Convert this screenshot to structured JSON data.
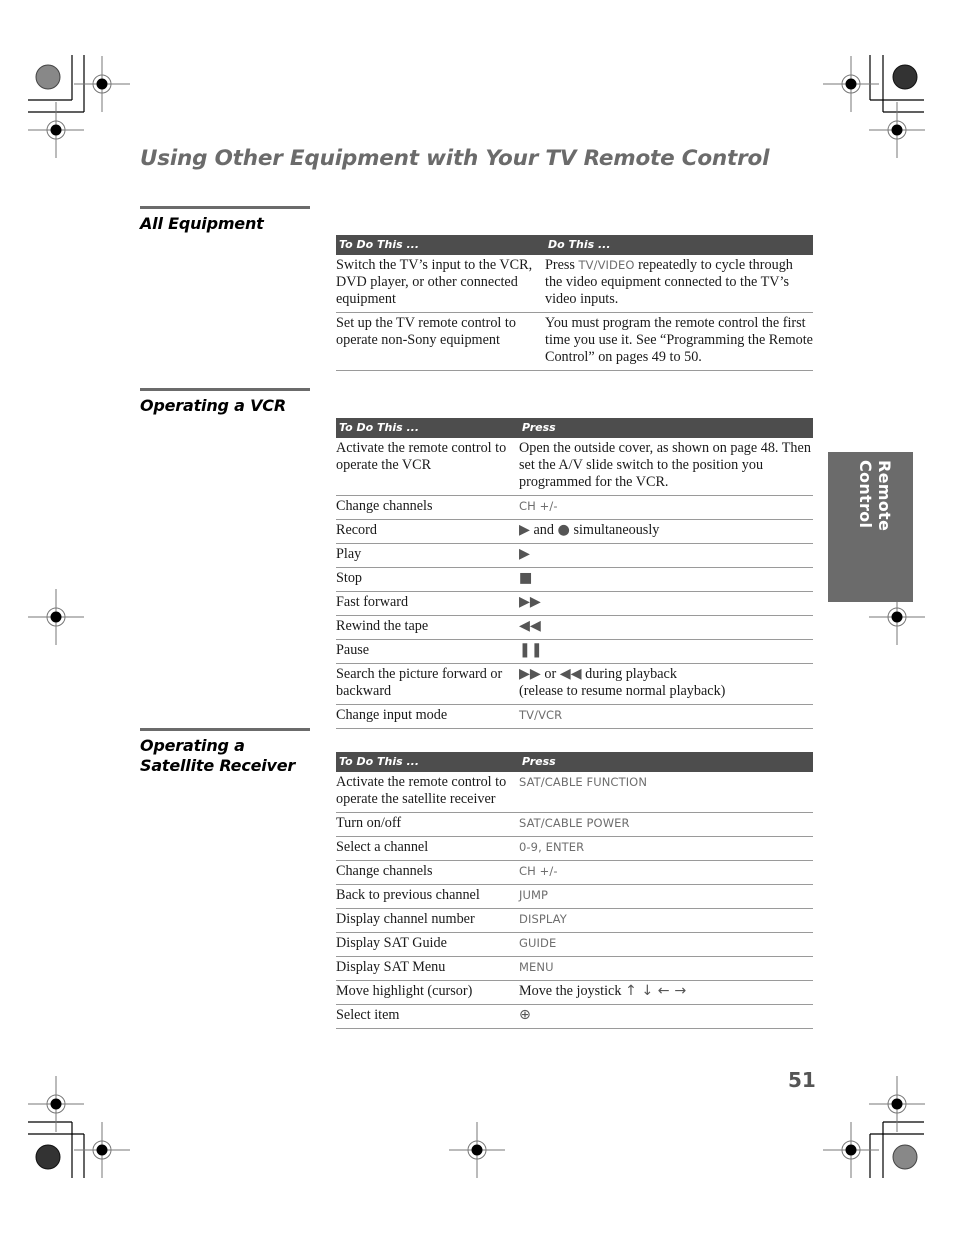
{
  "page": {
    "title": "Using Other Equipment with Your TV Remote Control",
    "side_tab": "Remote Control",
    "page_number": "51"
  },
  "sections": [
    {
      "title": "All Equipment",
      "headers": [
        "To Do This ...",
        "Do This ..."
      ],
      "rows": [
        {
          "action": "Switch the TV’s input to the VCR, DVD player, or other connected equipment",
          "pre": "Press ",
          "button": "TV/VIDEO",
          "post": " repeatedly to cycle through the video equipment connected to the TV’s video inputs."
        },
        {
          "action": "Set up the TV remote control to operate non-Sony equipment",
          "pre": "You must program the remote control the first time you use it. See “Programming the Remote Control” on pages 49 to 50.",
          "button": "",
          "post": ""
        }
      ]
    },
    {
      "title": "Operating a VCR",
      "headers": [
        "To Do This ...",
        "Press"
      ],
      "rows": [
        {
          "action": "Activate the remote control to operate the VCR",
          "pre": "Open the outside cover, as shown on page 48. Then set the A/V slide switch to the position you programmed for the VCR.",
          "button": "",
          "post": ""
        },
        {
          "action": "Change channels",
          "pre": "",
          "button": "CH +/-",
          "post": ""
        },
        {
          "action": "Record",
          "icons": [
            "play-icon"
          ],
          "pre": " and ",
          "icons2": [
            "record-icon"
          ],
          "post": " simultaneously"
        },
        {
          "action": "Play",
          "icons": [
            "play-icon"
          ]
        },
        {
          "action": "Stop",
          "icons": [
            "stop-icon"
          ]
        },
        {
          "action": "Fast forward",
          "icons": [
            "fast-forward-icon"
          ]
        },
        {
          "action": "Rewind the tape",
          "icons": [
            "rewind-icon"
          ]
        },
        {
          "action": "Pause",
          "icons": [
            "pause-icon"
          ]
        },
        {
          "action": "Search the picture forward or backward",
          "icons": [
            "fast-forward-icon"
          ],
          "pre": " or ",
          "icons2": [
            "rewind-icon"
          ],
          "post": " during playback",
          "line2": "(release to resume normal playback)"
        },
        {
          "action": "Change input mode",
          "pre": "",
          "button": "TV/VCR",
          "post": ""
        }
      ]
    },
    {
      "title_line1": "Operating a",
      "title_line2": "Satellite Receiver",
      "headers": [
        "To Do This ...",
        "Press"
      ],
      "rows": [
        {
          "action": "Activate the remote control to operate the satellite receiver",
          "button": "SAT/CABLE FUNCTION"
        },
        {
          "action": "Turn on/off",
          "button": "SAT/CABLE POWER"
        },
        {
          "action": "Select a channel",
          "button": "0-9, ENTER"
        },
        {
          "action": "Change channels",
          "button": "CH +/-"
        },
        {
          "action": "Back to previous channel",
          "button": "JUMP"
        },
        {
          "action": "Display channel number",
          "button": "DISPLAY"
        },
        {
          "action": "Display SAT Guide",
          "button": "GUIDE"
        },
        {
          "action": "Display SAT Menu",
          "button": "MENU"
        },
        {
          "action": "Move highlight (cursor)",
          "pre": "Move the joystick ",
          "arrows": "↑ ↓ ← →"
        },
        {
          "action": "Select item",
          "icons": [
            "joystick-select-icon"
          ]
        }
      ]
    }
  ],
  "glyphs": {
    "play-icon": "▶",
    "record-icon": "●",
    "stop-icon": "■",
    "fast-forward-icon": "▶▶",
    "rewind-icon": "◀◀",
    "pause-icon": "❚❚",
    "joystick-select-icon": "⊕"
  }
}
